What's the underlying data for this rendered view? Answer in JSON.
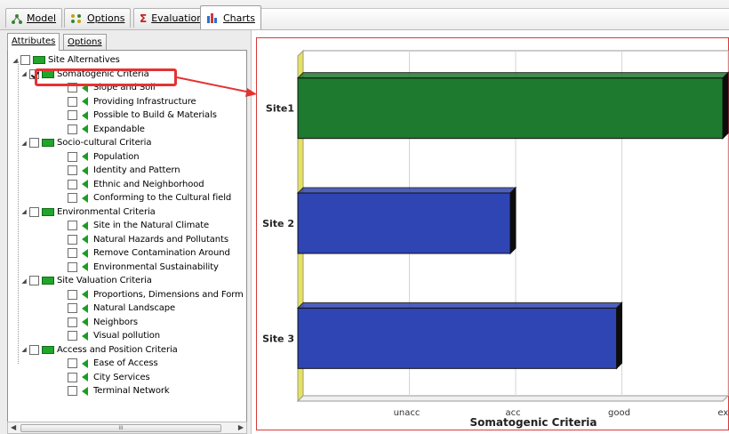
{
  "top_tabs": [
    {
      "label": "Model",
      "icon": "model-tree-icon"
    },
    {
      "label": "Options",
      "icon": "options-icon"
    },
    {
      "label": "Evaluation",
      "icon": "sigma-icon"
    },
    {
      "label": "Charts",
      "icon": "chart-icon"
    }
  ],
  "sub_tabs": [
    {
      "label": "Attributes"
    },
    {
      "label": "Options"
    }
  ],
  "tree": {
    "root": "Site Alternatives",
    "groups": [
      {
        "label": "Somatogenic Criteria",
        "checked": true,
        "items": [
          "Slope and Soil",
          "Providing Infrastructure",
          "Possible to Build & Materials",
          "Expandable"
        ]
      },
      {
        "label": "Socio-cultural Criteria",
        "checked": false,
        "items": [
          "Population",
          "Identity and Pattern",
          "Ethnic and Neighborhood",
          "Conforming to the Cultural field"
        ]
      },
      {
        "label": "Environmental Criteria",
        "checked": false,
        "items": [
          "Site in the Natural Climate",
          "Natural Hazards and Pollutants",
          "Remove Contamination Around",
          "Environmental Sustainability"
        ]
      },
      {
        "label": "Site Valuation Criteria",
        "checked": false,
        "items": [
          "Proportions, Dimensions and Form",
          "Natural Landscape",
          "Neighbors",
          "Visual pollution"
        ]
      },
      {
        "label": "Access and Position Criteria",
        "checked": false,
        "items": [
          "Ease of Access",
          "City Services",
          "Terminal Network"
        ]
      }
    ]
  },
  "scrollbar": {
    "thumb_label": "III"
  },
  "colors": {
    "highlight": "#e53232",
    "bar_green": "#1d7a2e",
    "bar_blue": "#2f45b3",
    "axis_wall": "#e6e25a"
  },
  "chart_data": {
    "type": "bar",
    "orientation": "horizontal",
    "categories": [
      "Site1",
      "Site 2",
      "Site 3"
    ],
    "values": [
      4,
      2,
      3
    ],
    "x_ticks": [
      "unacc",
      "acc",
      "good",
      "exc"
    ],
    "xlabel": "Somatogenic Criteria",
    "ylabel": "",
    "xlim": [
      0,
      4
    ],
    "bar_colors": [
      "#1d7a2e",
      "#2f45b3",
      "#2f45b3"
    ],
    "grid": true
  }
}
